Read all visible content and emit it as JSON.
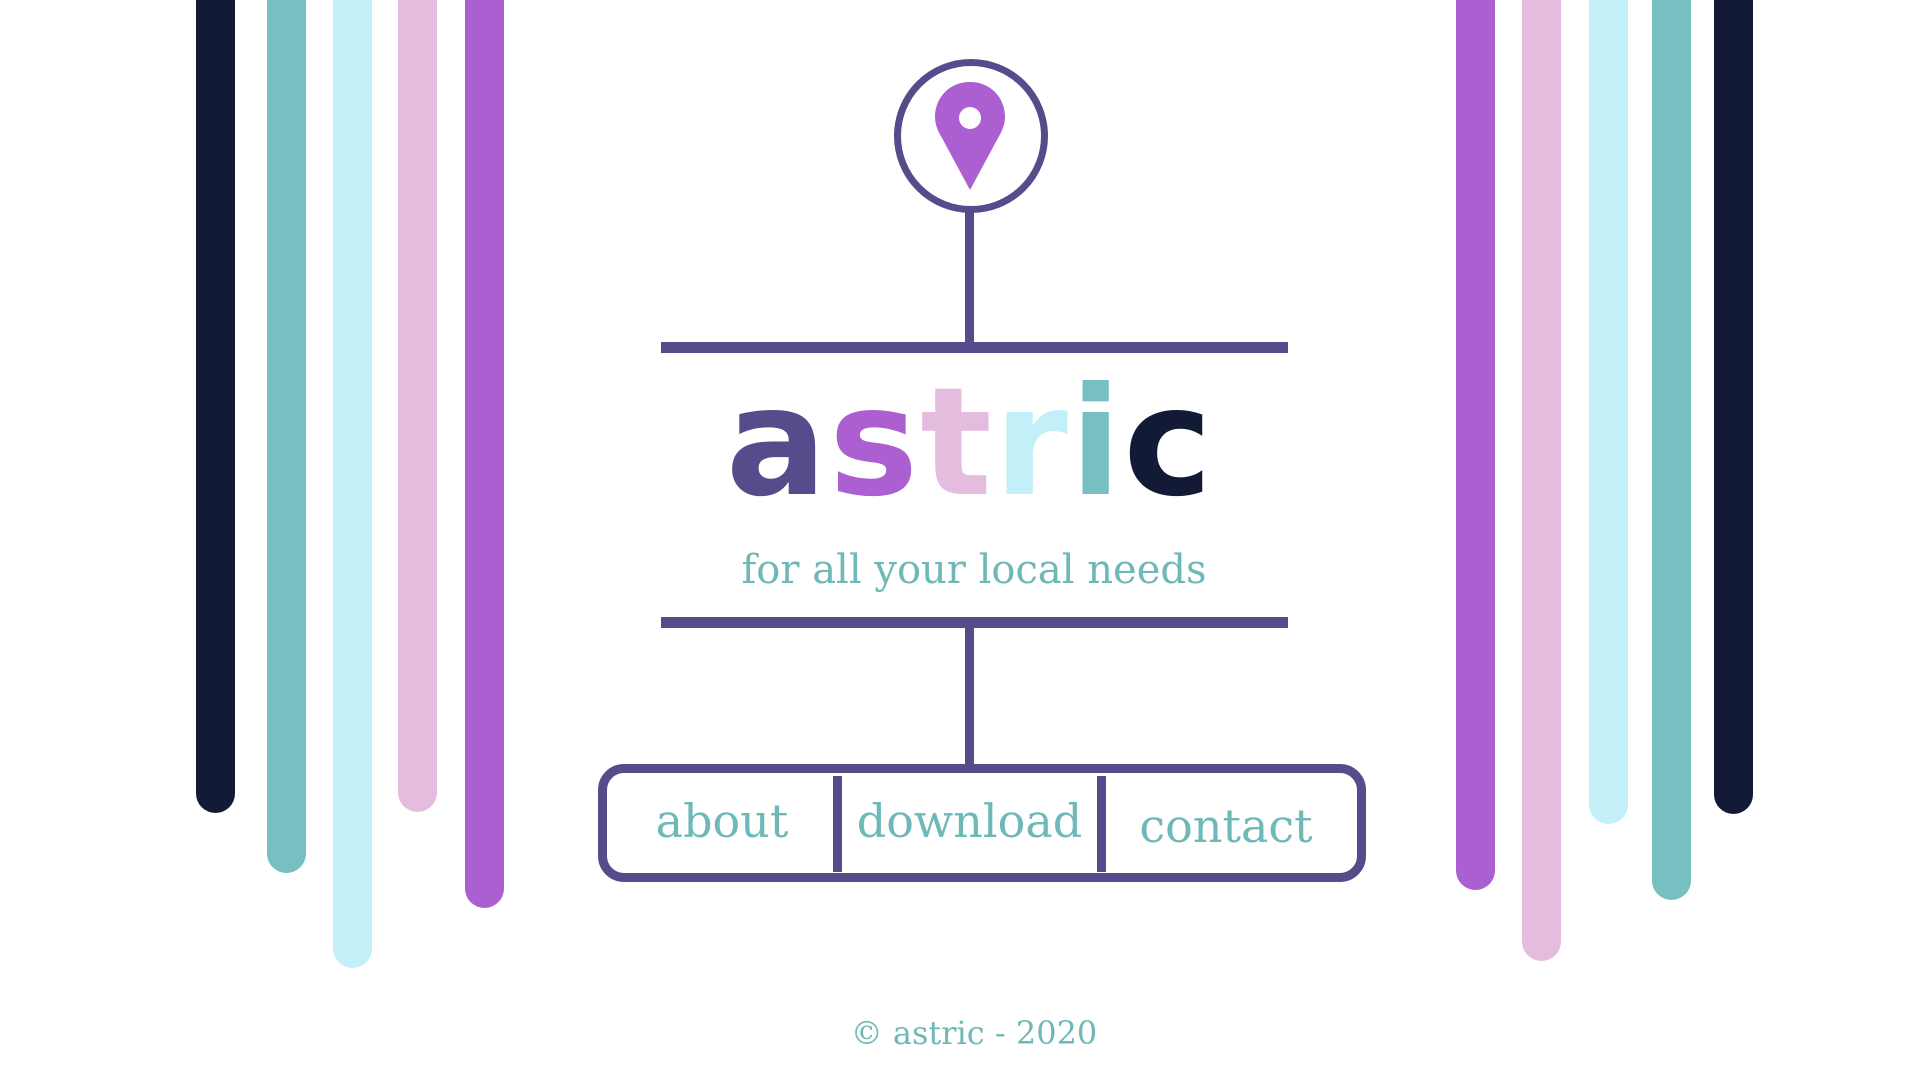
{
  "colors": {
    "navy": "#131a36",
    "teal": "#78bfc1",
    "light_blue": "#c3eff9",
    "pink": "#e3bcde",
    "purple": "#ab5fd0",
    "dark_purple": "#574b8b",
    "text_teal": "#6fb8b8"
  },
  "logo": {
    "letters": [
      {
        "char": "a",
        "color": "#574b8b"
      },
      {
        "char": "s",
        "color": "#ab5fd0"
      },
      {
        "char": "t",
        "color": "#e3bcde"
      },
      {
        "char": "r",
        "color": "#c3eff9"
      },
      {
        "char": "i",
        "color": "#78bfc1"
      },
      {
        "char": "c",
        "color": "#131a36"
      }
    ],
    "icon": "map-pin-icon"
  },
  "tagline": "for all your local needs",
  "nav": {
    "about": "about",
    "download": "download",
    "contact": "contact"
  },
  "footer": "© astric - 2020"
}
